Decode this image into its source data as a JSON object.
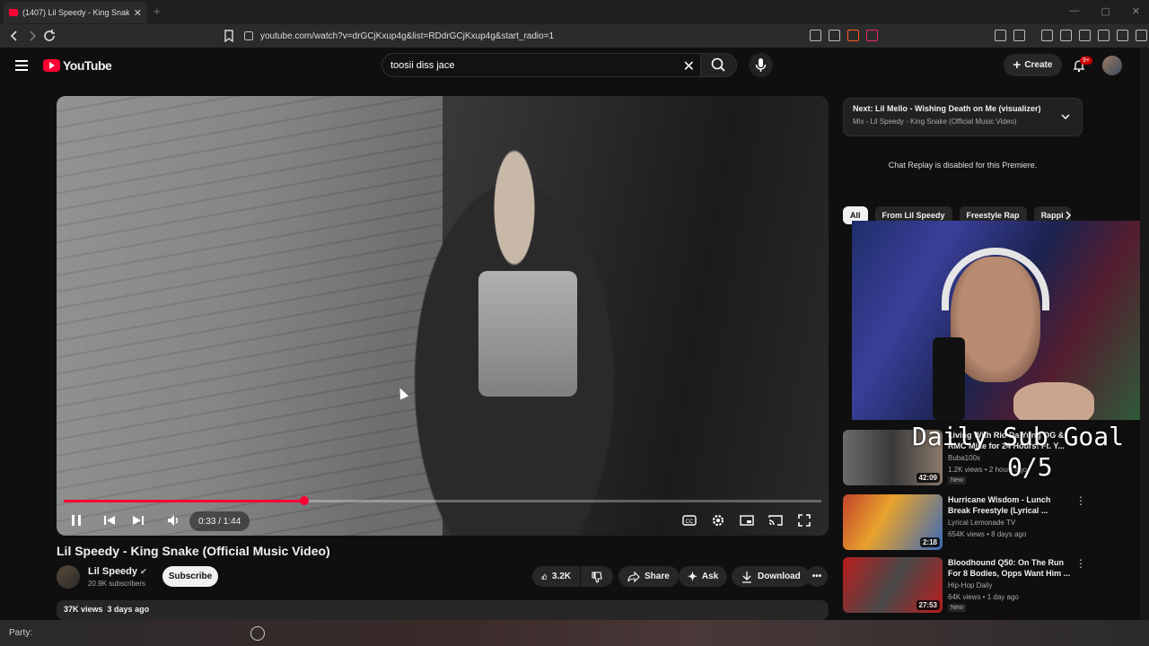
{
  "browser": {
    "tab_title": "(1407) Lil Speedy - King Snak",
    "url": "youtube.com/watch?v=drGCjKxup4g&list=RDdrGCjKxup4g&start_radio=1"
  },
  "header": {
    "logo_text": "YouTube",
    "search_value": "toosii diss jace",
    "create_label": "Create",
    "notif_badge": "9+"
  },
  "player": {
    "time": "0:33 / 1:44",
    "progress_fraction": 0.318
  },
  "video": {
    "title": "Lil Speedy - King Snake (Official Music Video)",
    "channel": "Lil Speedy",
    "subscribers": "20.9K subscribers",
    "subscribe_label": "Subscribe",
    "likes": "3.2K",
    "share_label": "Share",
    "ask_label": "Ask",
    "download_label": "Download",
    "views": "37K views",
    "age": "3 days ago"
  },
  "sidebar": {
    "next_label": "Next:",
    "next_title": "Lil Mello - Wishing Death on Me (visualizer)",
    "next_sub": "Mix - Lil Speedy - King Snake (Official Music Video)",
    "chat_replay": "Chat Replay is disabled for this Premiere.",
    "chips": [
      "All",
      "From Lil Speedy",
      "Freestyle Rap",
      "Rappi"
    ],
    "recommendations": [
      {
        "title": "Living With Rio Da Yung OG & RMC Mike for 24 Hours! Ft. Y...",
        "channel": "Buba100x",
        "meta": "1.2K views • 2 hours ago",
        "badge": "New",
        "duration": "42:09"
      },
      {
        "title": "Hurricane Wisdom - Lunch Break Freestyle (Lyrical ...",
        "channel": "Lyrical Lemonade TV",
        "meta": "654K views • 8 days ago",
        "badge": "",
        "duration": "2:18"
      },
      {
        "title": "Bloodhound Q50: On The Run For 8 Bodies, Opps Want Him ...",
        "channel": "Hip-Hop Daily",
        "meta": "64K views • 1 day ago",
        "badge": "New",
        "duration": "27:53"
      }
    ]
  },
  "overlay": {
    "goal_label": "Daily Sub Goal",
    "goal_count": "0/5"
  },
  "partybar": {
    "label": "Party:"
  },
  "colors": {
    "accent": "#ff0033",
    "background": "#0f0f0f"
  }
}
